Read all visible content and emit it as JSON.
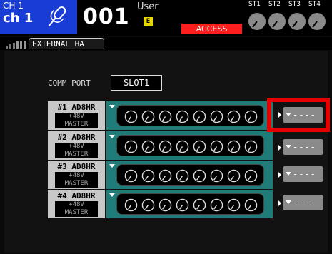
{
  "channel": {
    "line1": "CH 1",
    "line2": "ch 1"
  },
  "scene": {
    "number": "001",
    "user_label": "User",
    "edit_mark": "E"
  },
  "access_label": "ACCESS",
  "stereo": [
    "ST1",
    "ST2",
    "ST3",
    "ST4"
  ],
  "tab": {
    "label": "EXTERNAL HA"
  },
  "comm_port": {
    "label": "COMM PORT",
    "value": "SLOT1"
  },
  "slots": [
    {
      "name": "#1 AD8HR",
      "badge1": "+48V",
      "badge2": "MASTER",
      "assign": "----"
    },
    {
      "name": "#2 AD8HR",
      "badge1": "+48V",
      "badge2": "MASTER",
      "assign": "----"
    },
    {
      "name": "#3 AD8HR",
      "badge1": "+48V",
      "badge2": "MASTER",
      "assign": "----"
    },
    {
      "name": "#4 AD8HR",
      "badge1": "+48V",
      "badge2": "MASTER",
      "assign": "----"
    }
  ],
  "colors": {
    "channel_bg": "#1a3cd6",
    "access_bg": "#ff1e1e",
    "unit_teal": "#1f7c78",
    "highlight": "#e60000"
  }
}
